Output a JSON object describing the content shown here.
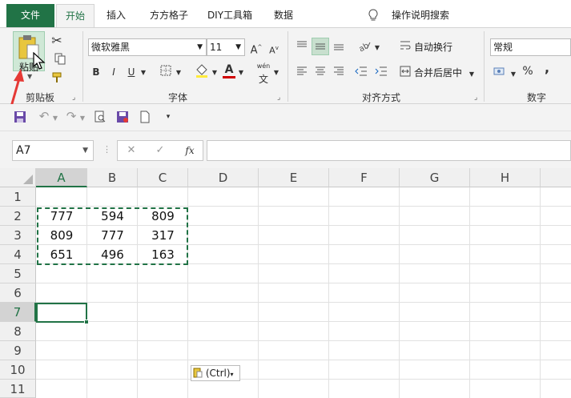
{
  "tabs": {
    "file": "文件",
    "home": "开始",
    "insert": "插入",
    "ffgz": "方方格子",
    "diy": "DIY工具箱",
    "data": "数据",
    "tellme": "操作说明搜索"
  },
  "ribbon": {
    "clipboard": {
      "paste_label": "粘贴",
      "group_label": "剪贴板"
    },
    "font": {
      "font_name": "微软雅黑",
      "font_size": "11",
      "bold": "B",
      "italic": "I",
      "underline": "U",
      "grow": "A",
      "shrink": "A",
      "font_color_glyph": "A",
      "phonetic_top": "wén",
      "phonetic_bottom": "文",
      "group_label": "字体"
    },
    "alignment": {
      "wrap_text": "自动换行",
      "merge_center": "合并后居中",
      "group_label": "对齐方式"
    },
    "number": {
      "format": "常规",
      "percent": "%",
      "comma": ",",
      "group_label": "数字"
    }
  },
  "formula_bar": {
    "name_box": "A7",
    "fx": "fx",
    "cancel": "✕",
    "confirm": "✓",
    "formula": ""
  },
  "sheet": {
    "columns": [
      "A",
      "B",
      "C",
      "D",
      "E",
      "F",
      "G",
      "H"
    ],
    "rows": [
      "1",
      "2",
      "3",
      "4",
      "5",
      "6",
      "7",
      "8",
      "9",
      "10",
      "11"
    ],
    "cells": [
      [
        "777",
        "594",
        "809"
      ],
      [
        "809",
        "777",
        "317"
      ],
      [
        "651",
        "496",
        "163"
      ]
    ],
    "paste_options": "(Ctrl)"
  },
  "colors": {
    "accent": "#217346",
    "arrow": "#e53935",
    "paste_icon": "#e8c63e",
    "font_color": "#d00000"
  }
}
